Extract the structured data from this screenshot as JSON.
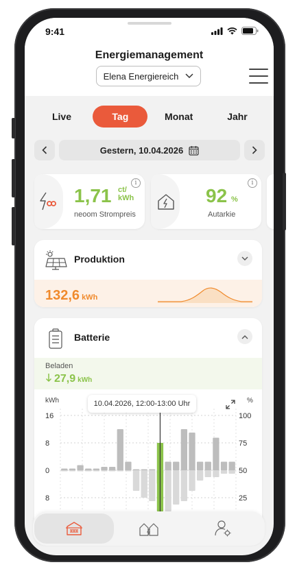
{
  "status_bar": {
    "time": "9:41"
  },
  "header": {
    "title": "Energiemanagement",
    "account": "Elena Energiereich"
  },
  "tabs": [
    {
      "label": "Live",
      "active": false
    },
    {
      "label": "Tag",
      "active": true
    },
    {
      "label": "Monat",
      "active": false
    },
    {
      "label": "Jahr",
      "active": false
    }
  ],
  "date_nav": {
    "label": "Gestern, 10.04.2026"
  },
  "kpis": {
    "price": {
      "value": "1,71",
      "unit_top": "ct/",
      "unit_bottom": "kWh",
      "label": "neoom Strompreis"
    },
    "autarky": {
      "value": "92",
      "unit": "%",
      "label": "Autarkie"
    }
  },
  "production": {
    "title": "Produktion",
    "value": "132,6",
    "unit": "kWh"
  },
  "battery": {
    "title": "Batterie",
    "charged_label": "Beladen",
    "charged_value": "27,9",
    "charged_unit": "kWh"
  },
  "chart_data": {
    "type": "bar",
    "left_axis_label": "kWh",
    "right_axis_label": "%",
    "left_ticks": [
      "16",
      "8",
      "0",
      "8"
    ],
    "right_ticks": [
      "100",
      "75",
      "50",
      "25"
    ],
    "tooltip": "10.04.2026, 12:00-13:00 Uhr",
    "highlighted_index": 12,
    "series": [
      {
        "values": [
          0.5,
          0.5,
          1.5,
          0.5,
          0.5,
          1,
          1,
          12,
          2.5,
          -6,
          -6,
          -7,
          -1,
          2.5,
          2.5,
          12,
          11,
          2.5,
          2.5,
          9.5,
          2.5,
          2.5
        ]
      },
      {
        "values": [
          -0.2,
          -0.2,
          -0.2,
          -0.2,
          -0.2,
          -0.2,
          -0.2,
          -0.2,
          -0.2,
          -6,
          -8,
          -9,
          -12,
          -12,
          -10,
          -9,
          -6,
          -3,
          -2,
          -2,
          -1,
          -1
        ]
      },
      {
        "values": [
          0.3,
          0.3,
          0.3,
          0.3,
          0.3,
          0.3,
          0.3,
          0.3,
          0.3,
          0.3,
          0.3,
          0.3,
          8,
          0.3,
          0.3,
          0.3,
          0.3,
          0.3,
          0.3,
          0.3,
          0.3,
          0.3
        ]
      },
      {
        "values": [
          0,
          0,
          0,
          0,
          0,
          0,
          0,
          0,
          0,
          0,
          0,
          0,
          -4,
          0,
          0,
          0,
          0,
          0,
          0,
          0,
          0,
          0
        ]
      }
    ],
    "colors": {
      "positive": "#bdbdbd",
      "negative": "#d9d9d9",
      "highlight": "#8bc34a",
      "axis": "#333333"
    }
  },
  "colors": {
    "accent": "#ea5a3b",
    "green": "#8bc34a",
    "orange": "#f08a2c"
  },
  "bottom_nav": {
    "items": [
      {
        "icon": "house-grid-icon",
        "active": true
      },
      {
        "icon": "home-energy-icon",
        "active": false
      },
      {
        "icon": "user-settings-icon",
        "active": false
      }
    ]
  }
}
